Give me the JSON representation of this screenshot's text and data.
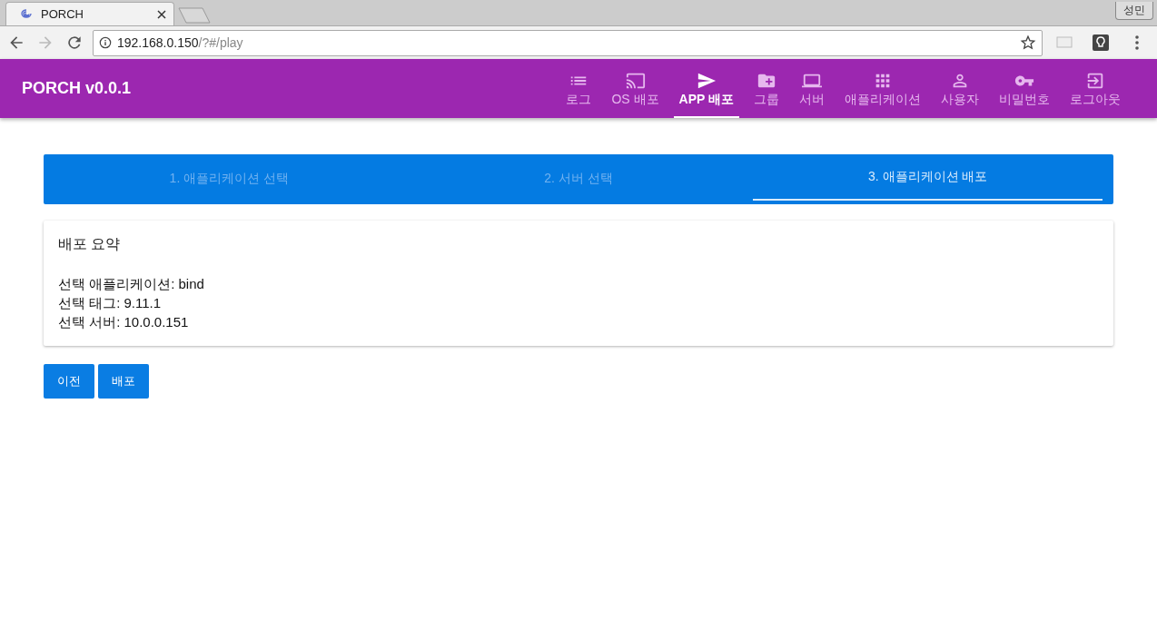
{
  "browser": {
    "tab_title": "PORCH",
    "url_host": "192.168.0.150",
    "url_path": "/?#/play",
    "profile": "성민"
  },
  "app": {
    "title": "PORCH v0.0.1",
    "nav": [
      {
        "label": "로그",
        "selected": false
      },
      {
        "label": "OS 배포",
        "selected": false
      },
      {
        "label": "APP 배포",
        "selected": true
      },
      {
        "label": "그룹",
        "selected": false
      },
      {
        "label": "서버",
        "selected": false
      },
      {
        "label": "애플리케이션",
        "selected": false
      },
      {
        "label": "사용자",
        "selected": false
      },
      {
        "label": "비밀번호",
        "selected": false
      },
      {
        "label": "로그아웃",
        "selected": false
      }
    ]
  },
  "steps": [
    {
      "label": "1. 애플리케이션 선택",
      "selected": false
    },
    {
      "label": "2. 서버 선택",
      "selected": false
    },
    {
      "label": "3. 애플리케이션 배포",
      "selected": true
    }
  ],
  "summary": {
    "title": "배포 요약",
    "lines": [
      "선택 애플리케이션: bind",
      "선택 태그: 9.11.1",
      "선택 서버: 10.0.0.151"
    ]
  },
  "buttons": [
    "이전",
    "배포"
  ]
}
